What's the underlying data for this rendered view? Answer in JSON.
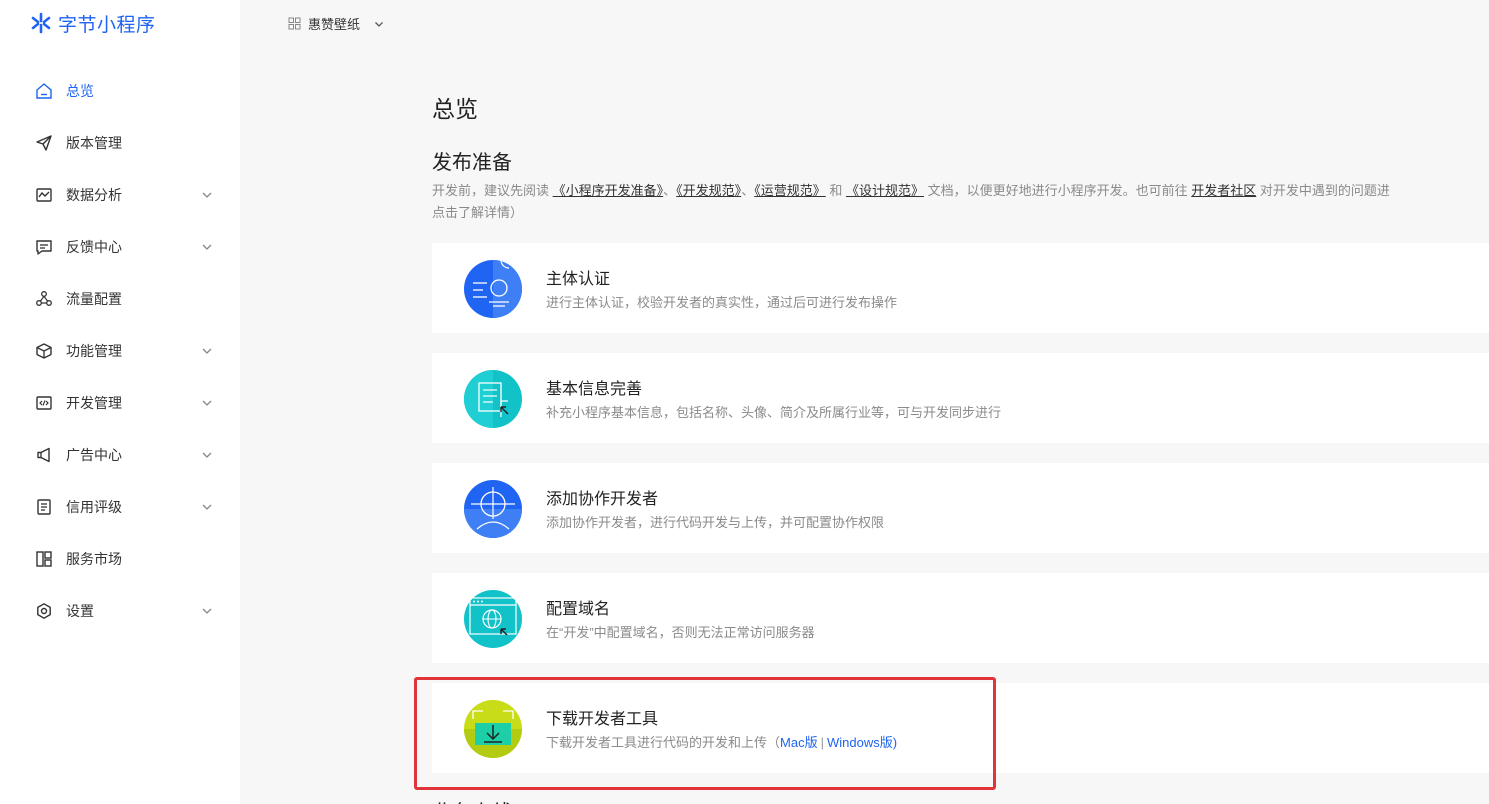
{
  "brand": {
    "name": "字节小程序",
    "color": "#1f64f2"
  },
  "app_selector": {
    "name": "惠赞壁纸"
  },
  "sidebar": {
    "items": [
      {
        "label": "总览",
        "icon": "home-icon",
        "active": true,
        "expandable": false
      },
      {
        "label": "版本管理",
        "icon": "send-icon",
        "active": false,
        "expandable": false
      },
      {
        "label": "数据分析",
        "icon": "chart-icon",
        "active": false,
        "expandable": true
      },
      {
        "label": "反馈中心",
        "icon": "message-icon",
        "active": false,
        "expandable": true
      },
      {
        "label": "流量配置",
        "icon": "traffic-icon",
        "active": false,
        "expandable": false
      },
      {
        "label": "功能管理",
        "icon": "cube-icon",
        "active": false,
        "expandable": true
      },
      {
        "label": "开发管理",
        "icon": "code-icon",
        "active": false,
        "expandable": true
      },
      {
        "label": "广告中心",
        "icon": "megaphone-icon",
        "active": false,
        "expandable": true
      },
      {
        "label": "信用评级",
        "icon": "document-icon",
        "active": false,
        "expandable": true
      },
      {
        "label": "服务市场",
        "icon": "grid-icon",
        "active": false,
        "expandable": false
      },
      {
        "label": "设置",
        "icon": "settings-icon",
        "active": false,
        "expandable": true
      }
    ]
  },
  "main": {
    "title": "总览",
    "section_title": "发布准备",
    "intro": {
      "p1": "开发前，建议先阅读",
      "link1": "《小程序开发准备》",
      "p2": "、",
      "link2": "《开发规范》",
      "p3": "、",
      "link3": "《运营规范》",
      "p4": " 和 ",
      "link4": "《设计规范》",
      "p5": " 文档，以便更好地进行小程序开发。也可前往 ",
      "link5": "开发者社区",
      "p6": " 对开发中遇到的问题进",
      "line2": "点击了解详情）"
    },
    "cards": [
      {
        "title": "主体认证",
        "desc": "进行主体认证，校验开发者的真实性，通过后可进行发布操作",
        "icon": "identity-icon"
      },
      {
        "title": "基本信息完善",
        "desc": "补充小程序基本信息，包括名称、头像、简介及所属行业等，可与开发同步进行",
        "icon": "profile-info-icon"
      },
      {
        "title": "添加协作开发者",
        "desc": "添加协作开发者，进行代码开发与上传，并可配置协作权限",
        "icon": "collaborator-icon"
      },
      {
        "title": "配置域名",
        "desc": "在“开发”中配置域名，否则无法正常访问服务器",
        "icon": "domain-icon"
      },
      {
        "title": "下载开发者工具",
        "desc": "下载开发者工具进行代码的开发和上传（",
        "mac": "Mac版",
        "sep": "|",
        "win": "Windows版",
        "close": ")",
        "icon": "download-tool-icon"
      }
    ],
    "next_section": "业务上线"
  },
  "colors": {
    "highlight": "#e0343a",
    "link": "#1f64f2",
    "page_bg": "#f7f7f8"
  }
}
